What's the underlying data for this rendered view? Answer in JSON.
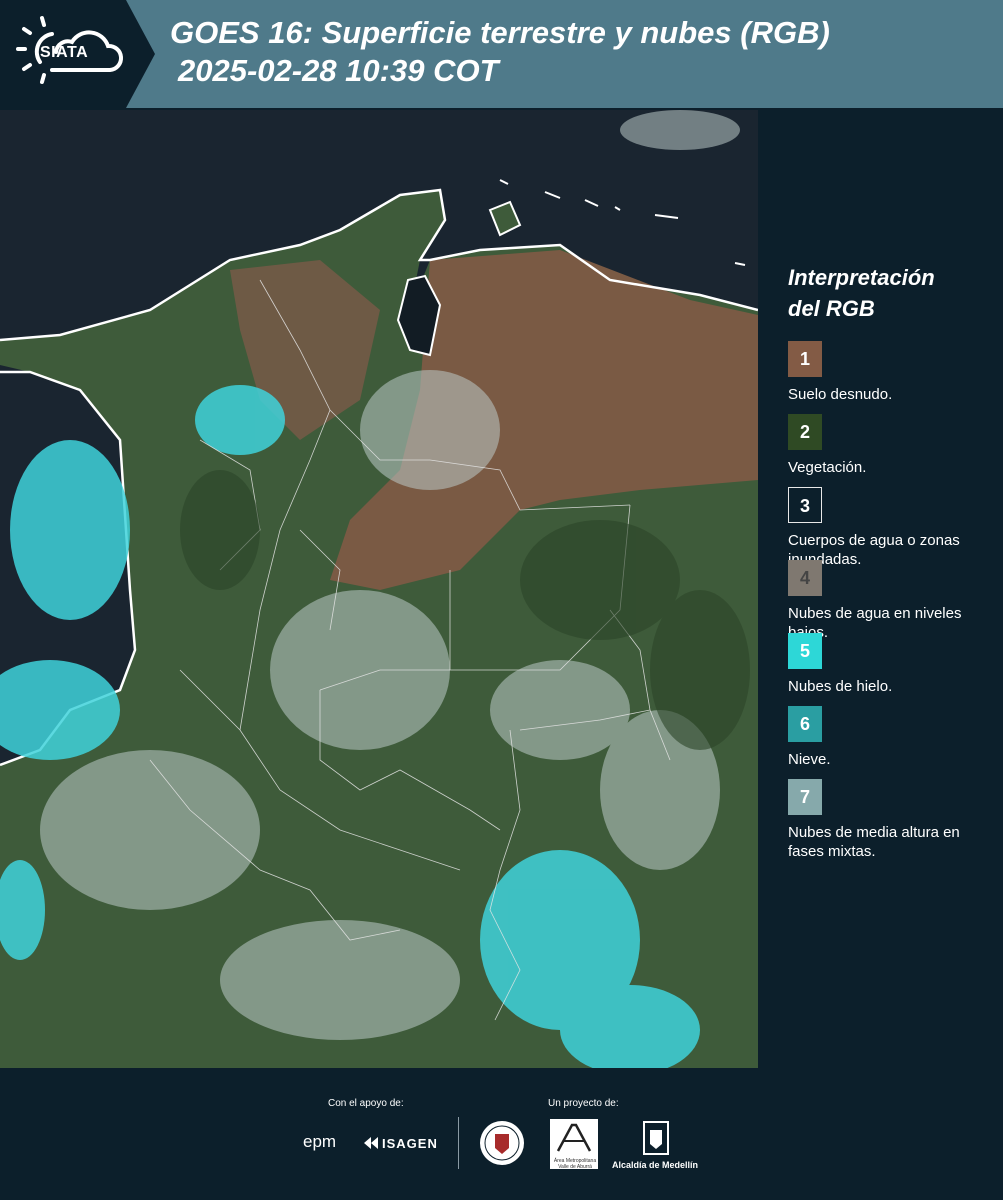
{
  "header": {
    "logo_text": "SIATA",
    "title_line1": "GOES 16: Superficie terrestre y nubes (RGB)",
    "title_line2": "2025-02-28 10:39 COT"
  },
  "map": {
    "image": "satellite-rgb-colombia",
    "colors": {
      "ocean": "#1a2530",
      "land": "#3d5a3a",
      "bare_soil": "#7a5a42",
      "ice_cloud": "#3fd4dc",
      "low_cloud": "#b9c9c7"
    }
  },
  "legend": {
    "title_line1": "Interpretación",
    "title_line2": "del RGB",
    "items": [
      {
        "number": "1",
        "color": "#835b45",
        "label": "Suelo desnudo."
      },
      {
        "number": "2",
        "color": "#2f4a24",
        "label": "Vegetación."
      },
      {
        "number": "3",
        "color": "#0c1f2b",
        "label": "Cuerpos de agua o zonas inundadas."
      },
      {
        "number": "4",
        "color": "#7f7870",
        "label": "Nubes de agua en niveles bajos."
      },
      {
        "number": "5",
        "color": "#2dd7d7",
        "label": "Nubes de hielo."
      },
      {
        "number": "6",
        "color": "#2a9ea2",
        "label": "Nieve."
      },
      {
        "number": "7",
        "color": "#86a9ab",
        "label": "Nubes de media altura en fases mixtas."
      }
    ]
  },
  "footer": {
    "support_label": "Con el apoyo de:",
    "project_label": "Un proyecto de:",
    "sponsors": [
      "epm",
      "ISAGEN"
    ],
    "partners": [
      "Área Metropolitana Valle de Aburrá",
      "Alcaldía de Medellín"
    ],
    "alcaldia_label": "Alcaldía de Medellín"
  }
}
